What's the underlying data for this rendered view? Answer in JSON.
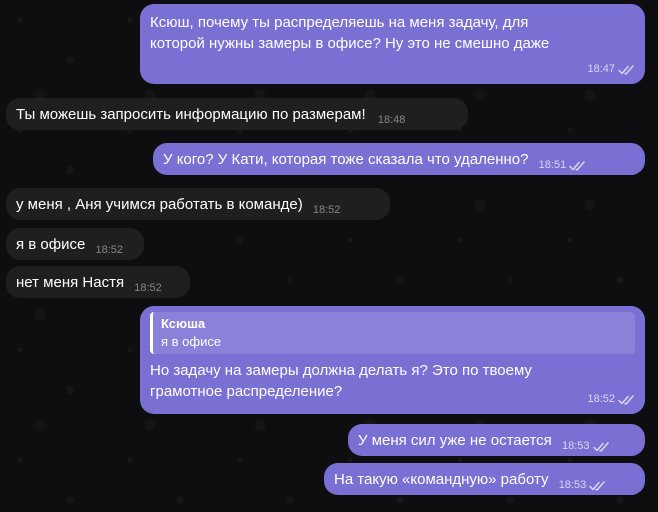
{
  "colors": {
    "background": "#0e0e10",
    "incoming": "#1f1f22",
    "outgoing": "#7a6fd3"
  },
  "messages": [
    {
      "id": "m1",
      "direction": "out",
      "lines": [
        "Ксюш, почему ты распределяешь на меня задачу, для",
        "которой нужны замеры в офисе? Ну это не смешно даже"
      ],
      "time": "18:47",
      "read": true
    },
    {
      "id": "m2",
      "direction": "in",
      "text": "Ты можешь запросить информацию по размерам!",
      "time": "18:48"
    },
    {
      "id": "m3",
      "direction": "out",
      "text": "У кого? У Кати, которая тоже сказала что удаленно?",
      "time": "18:51",
      "read": true
    },
    {
      "id": "m4",
      "direction": "in",
      "text": "у меня , Аня учимся работать в команде)",
      "time": "18:52"
    },
    {
      "id": "m5",
      "direction": "in",
      "text": "я в офисе",
      "time": "18:52"
    },
    {
      "id": "m6",
      "direction": "in",
      "text": "нет меня Настя",
      "time": "18:52"
    },
    {
      "id": "m7",
      "direction": "out",
      "reply_to": {
        "name": "Ксюша",
        "text": "я в офисе"
      },
      "lines": [
        "Но задачу на замеры должна делать я? Это по твоему",
        "грамотное распределение?"
      ],
      "time": "18:52",
      "read": true
    },
    {
      "id": "m8",
      "direction": "out",
      "text": "У меня сил уже не остается",
      "time": "18:53",
      "read": true
    },
    {
      "id": "m9",
      "direction": "out",
      "text": "На такую «командную» работу",
      "time": "18:53",
      "read": true
    }
  ]
}
